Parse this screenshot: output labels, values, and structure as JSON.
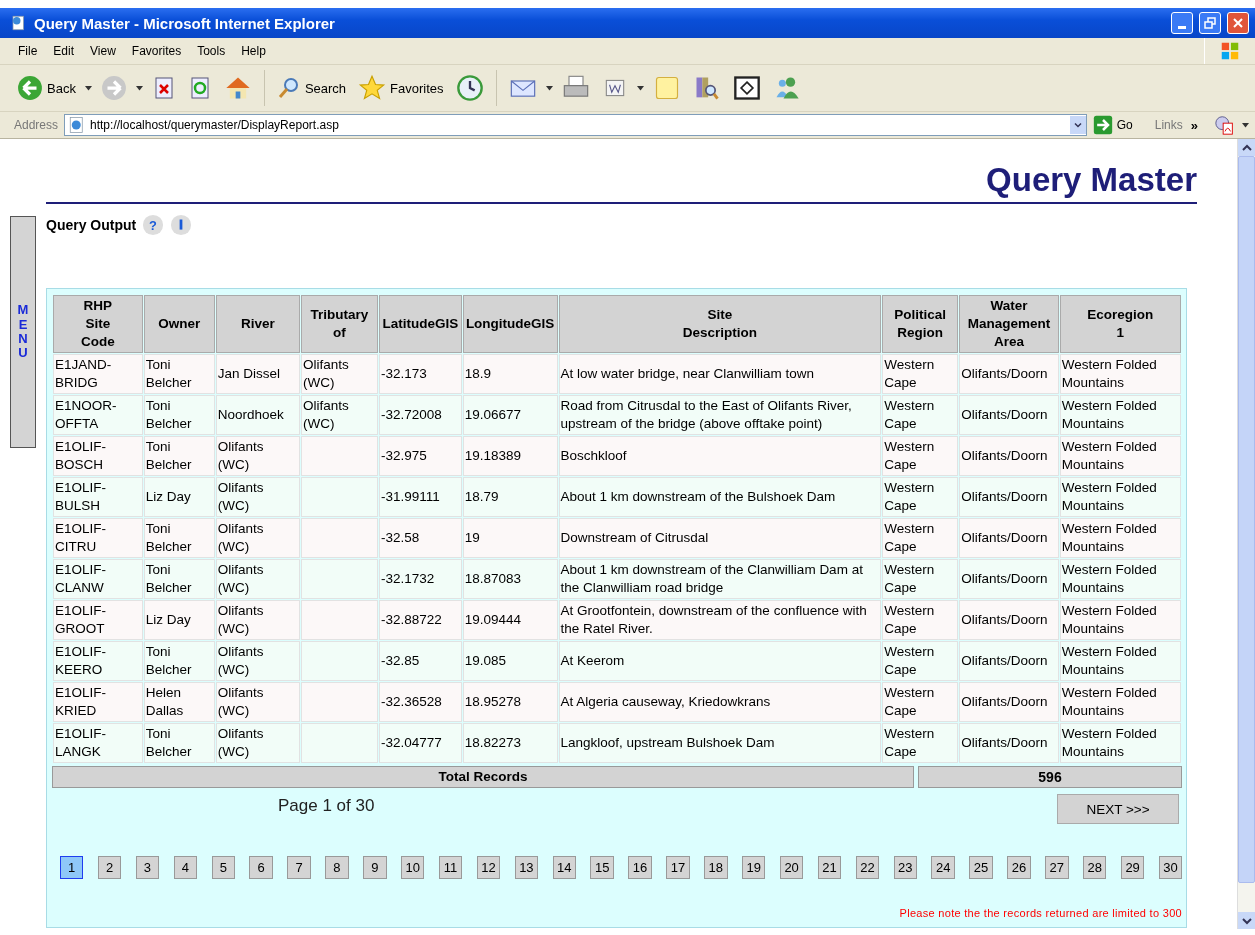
{
  "window": {
    "title": "Query Master - Microsoft Internet Explorer"
  },
  "menu_bar": [
    "File",
    "Edit",
    "View",
    "Favorites",
    "Tools",
    "Help"
  ],
  "toolbar": {
    "back_label": "Back",
    "search_label": "Search",
    "favorites_label": "Favorites"
  },
  "address_bar": {
    "label": "Address",
    "url": "http://localhost/querymaster/DisplayReport.asp",
    "go": "Go",
    "links": "Links",
    "links_chevron": "»"
  },
  "page": {
    "title": "Query Master",
    "menu_tab": "MENU",
    "section": "Query Output",
    "help_glyph": "?",
    "table": {
      "columns": [
        "RHP\nSite\nCode",
        "Owner",
        "River",
        "Tributary\nof",
        "LatitudeGIS",
        "LongitudeGIS",
        "Site\nDescription",
        "Political\nRegion",
        "Water\nManagement\nArea",
        "Ecoregion\n1"
      ],
      "rows": [
        [
          "E1JAND-BRIDG",
          "Toni Belcher",
          "Jan Dissel",
          "Olifants (WC)",
          "-32.173",
          "18.9",
          "At low water bridge, near Clanwilliam town",
          "Western Cape",
          "Olifants/Doorn",
          "Western Folded Mountains"
        ],
        [
          "E1NOOR-OFFTA",
          "Toni Belcher",
          "Noordhoek",
          "Olifants (WC)",
          "-32.72008",
          "19.06677",
          "Road from Citrusdal to the East of Olifants River, upstream of the bridge (above offtake point)",
          "Western Cape",
          "Olifants/Doorn",
          "Western Folded Mountains"
        ],
        [
          "E1OLIF-BOSCH",
          "Toni Belcher",
          "Olifants (WC)",
          "",
          "-32.975",
          "19.18389",
          "Boschkloof",
          "Western Cape",
          "Olifants/Doorn",
          "Western Folded Mountains"
        ],
        [
          "E1OLIF-BULSH",
          "Liz Day",
          "Olifants (WC)",
          "",
          "-31.99111",
          "18.79",
          "About 1 km downstream of the Bulshoek Dam",
          "Western Cape",
          "Olifants/Doorn",
          "Western Folded Mountains"
        ],
        [
          "E1OLIF-CITRU",
          "Toni Belcher",
          "Olifants (WC)",
          "",
          "-32.58",
          "19",
          "Downstream of Citrusdal",
          "Western Cape",
          "Olifants/Doorn",
          "Western Folded Mountains"
        ],
        [
          "E1OLIF-CLANW",
          "Toni Belcher",
          "Olifants (WC)",
          "",
          "-32.1732",
          "18.87083",
          "About 1 km downstream of the Clanwilliam Dam at the Clanwilliam road bridge",
          "Western Cape",
          "Olifants/Doorn",
          "Western Folded Mountains"
        ],
        [
          "E1OLIF-GROOT",
          "Liz Day",
          "Olifants (WC)",
          "",
          "-32.88722",
          "19.09444",
          "At Grootfontein, downstream of the confluence with the Ratel River.",
          "Western Cape",
          "Olifants/Doorn",
          "Western Folded Mountains"
        ],
        [
          "E1OLIF-KEERO",
          "Toni Belcher",
          "Olifants (WC)",
          "",
          "-32.85",
          "19.085",
          "At Keerom",
          "Western Cape",
          "Olifants/Doorn",
          "Western Folded Mountains"
        ],
        [
          "E1OLIF-KRIED",
          "Helen Dallas",
          "Olifants (WC)",
          "",
          "-32.36528",
          "18.95278",
          "At Algeria causeway, Kriedowkrans",
          "Western Cape",
          "Olifants/Doorn",
          "Western Folded Mountains"
        ],
        [
          "E1OLIF-LANGK",
          "Toni Belcher",
          "Olifants (WC)",
          "",
          "-32.04777",
          "18.82273",
          "Langkloof, upstream Bulshoek Dam",
          "Western Cape",
          "Olifants/Doorn",
          "Western Folded Mountains"
        ]
      ]
    },
    "total": {
      "label": "Total Records",
      "value": "596"
    },
    "page_info": "Page 1 of 30",
    "next_button": "NEXT >>>",
    "pages": [
      {
        "label": "1",
        "selected": true
      },
      {
        "label": "2",
        "selected": false
      },
      {
        "label": "3",
        "selected": false
      },
      {
        "label": "4",
        "selected": false
      },
      {
        "label": "5",
        "selected": false
      },
      {
        "label": "6",
        "selected": false
      },
      {
        "label": "7",
        "selected": false
      },
      {
        "label": "8",
        "selected": false
      },
      {
        "label": "9",
        "selected": false
      },
      {
        "label": "10",
        "selected": false
      },
      {
        "label": "11",
        "selected": false
      },
      {
        "label": "12",
        "selected": false
      },
      {
        "label": "13",
        "selected": false
      },
      {
        "label": "14",
        "selected": false
      },
      {
        "label": "15",
        "selected": false
      },
      {
        "label": "16",
        "selected": false
      },
      {
        "label": "17",
        "selected": false
      },
      {
        "label": "18",
        "selected": false
      },
      {
        "label": "19",
        "selected": false
      },
      {
        "label": "20",
        "selected": false
      },
      {
        "label": "21",
        "selected": false
      },
      {
        "label": "22",
        "selected": false
      },
      {
        "label": "23",
        "selected": false
      },
      {
        "label": "24",
        "selected": false
      },
      {
        "label": "25",
        "selected": false
      },
      {
        "label": "26",
        "selected": false
      },
      {
        "label": "27",
        "selected": false
      },
      {
        "label": "28",
        "selected": false
      },
      {
        "label": "29",
        "selected": false
      },
      {
        "label": "30",
        "selected": false
      }
    ],
    "note": "Please note the the records returned are limited to 300"
  }
}
